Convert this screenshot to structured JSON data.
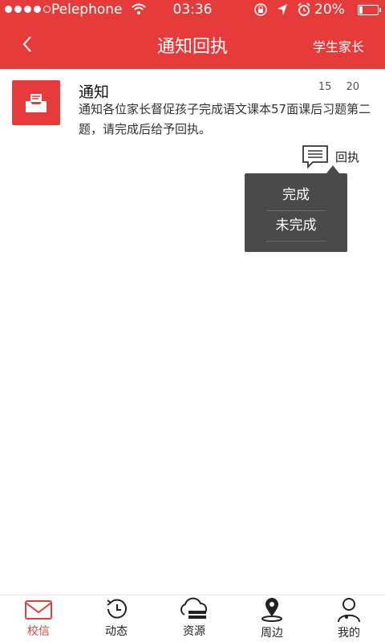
{
  "status_bar": {
    "carrier": "Pelephone",
    "time": "03:36",
    "battery_percent": "20%",
    "battery_level": 0.2,
    "signal_bars_filled": 4
  },
  "header": {
    "title": "通知回执",
    "role_label": "学生家长"
  },
  "notice": {
    "title": "通知",
    "time_hour": "15",
    "time_minute": "20",
    "body": "通知各位家长督促孩子完成语文课本57面课后习题第二题，请完成后给予回执。",
    "receipt_label": "回执"
  },
  "popup": {
    "options": [
      "完成",
      "未完成"
    ]
  },
  "tabs": [
    {
      "label": "校信",
      "icon": "mail-icon",
      "active": true
    },
    {
      "label": "动态",
      "icon": "clock-icon",
      "active": false
    },
    {
      "label": "资源",
      "icon": "cloud-server-icon",
      "active": false
    },
    {
      "label": "周边",
      "icon": "location-pin-icon",
      "active": false
    },
    {
      "label": "我的",
      "icon": "user-icon",
      "active": false
    }
  ],
  "colors": {
    "accent": "#e63b3b",
    "popup_bg": "#4a4a4a"
  }
}
